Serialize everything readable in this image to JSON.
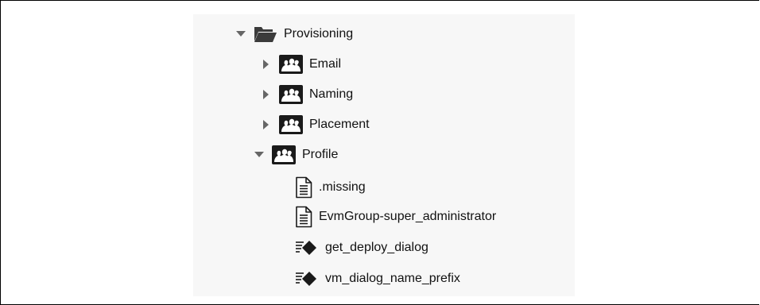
{
  "tree": {
    "root": {
      "label": "Provisioning",
      "icon": "folder-open-icon",
      "expanded": true
    },
    "children": [
      {
        "label": "Email",
        "icon": "class-group-icon",
        "expanded": false
      },
      {
        "label": "Naming",
        "icon": "class-group-icon",
        "expanded": false
      },
      {
        "label": "Placement",
        "icon": "class-group-icon",
        "expanded": false
      },
      {
        "label": "Profile",
        "icon": "class-group-icon",
        "expanded": true,
        "children": [
          {
            "label": ".missing",
            "icon": "document-icon"
          },
          {
            "label": "EvmGroup-super_administrator",
            "icon": "document-icon"
          },
          {
            "label": "get_deploy_dialog",
            "icon": "method-icon"
          },
          {
            "label": "vm_dialog_name_prefix",
            "icon": "method-icon"
          }
        ]
      }
    ]
  },
  "colors": {
    "panel_bg": "#f7f7f7",
    "toggle": "#666666",
    "icon_dark": "#1a1a1a",
    "folder": "#3b3b3b"
  }
}
